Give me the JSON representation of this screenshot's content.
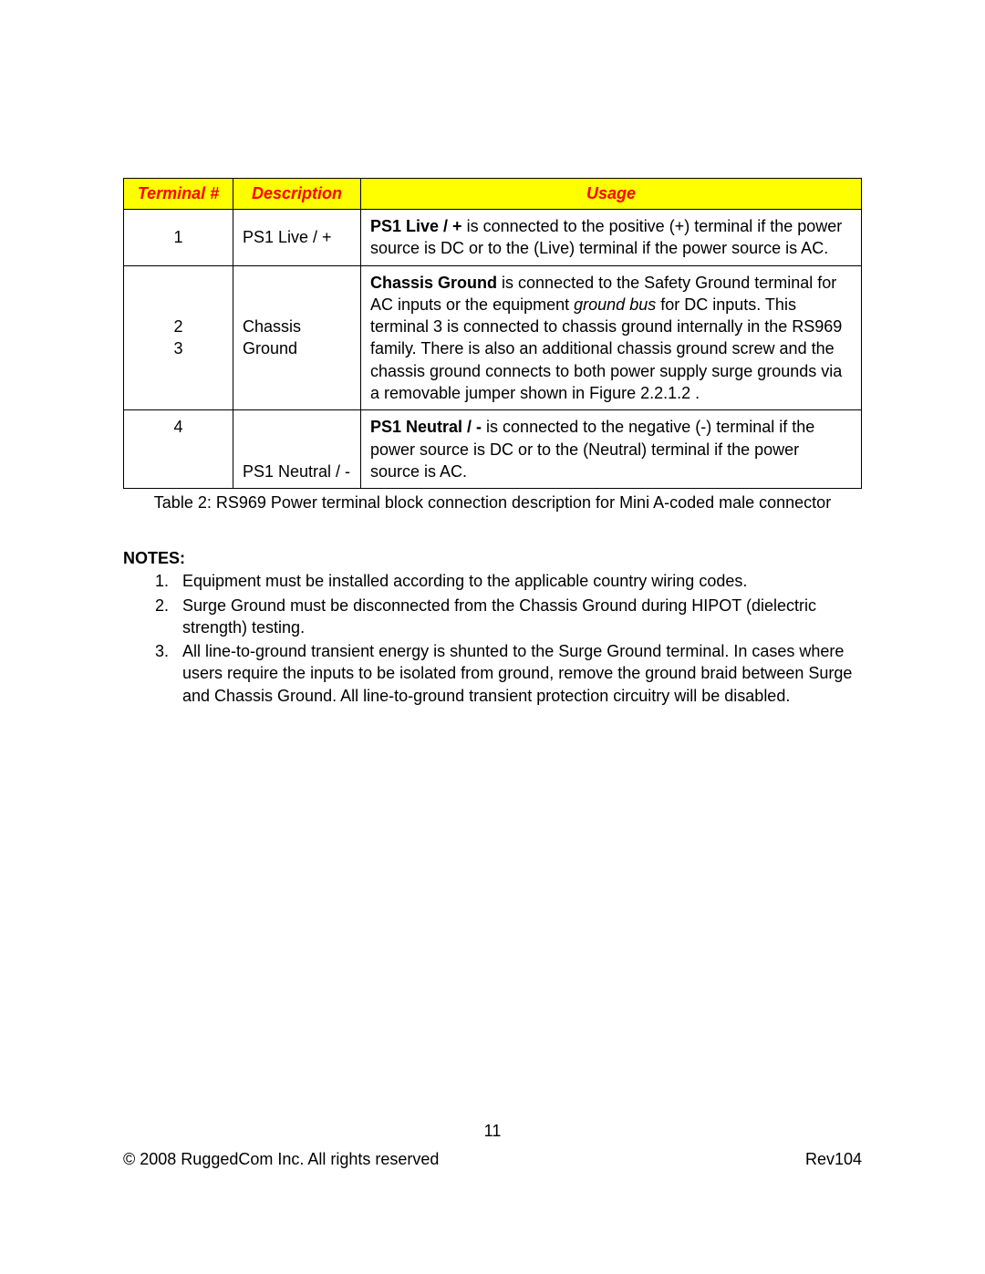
{
  "table": {
    "headers": {
      "terminal": "Terminal #",
      "description": "Description",
      "usage": "Usage"
    },
    "rows": [
      {
        "terminal": "1",
        "description": "PS1  Live / +",
        "usage_bold": "PS1 Live / +",
        "usage_rest": " is connected to the positive (+) terminal if the power source is DC or to the (Live) terminal if the power source is AC."
      },
      {
        "terminal_line1": "2",
        "terminal_line2": "3",
        "description_line1": "Chassis",
        "description_line2": "Ground",
        "usage_bold": "Chassis Ground",
        "usage_seg1": " is connected to the Safety Ground terminal for AC inputs or the equipment ",
        "usage_italic": "ground bus",
        "usage_seg2": " for DC inputs. This terminal 3 is connected to chassis ground internally in the RS969 family. There is also an additional chassis ground screw and the chassis ground connects to both power supply surge grounds via a removable jumper shown in Figure 2.2.1.2 ."
      },
      {
        "terminal": "4",
        "description": "PS1   Neutral / -",
        "usage_bold": "PS1 Neutral / -",
        "usage_rest": " is connected to the negative (-) terminal if the power source is DC or to the (Neutral) terminal if the power source is AC."
      }
    ],
    "caption": "Table 2: RS969 Power terminal block connection description for Mini A-coded male connector"
  },
  "notes": {
    "heading": "NOTES:",
    "items": [
      {
        "num": "1.",
        "text": "Equipment must be installed according to the applicable country wiring codes."
      },
      {
        "num": "2.",
        "text": "Surge Ground must be disconnected from the Chassis Ground during HIPOT (dielectric strength) testing."
      },
      {
        "num": "3.",
        "text": "All line-to-ground transient energy is shunted to the Surge Ground terminal.  In cases where users require the inputs to be isolated from ground, remove the ground braid between Surge and Chassis Ground. All line-to-ground transient protection circuitry will be disabled."
      }
    ]
  },
  "footer": {
    "page_number": "11",
    "copyright": "©  2008 RuggedCom Inc. All rights reserved",
    "revision": "Rev104"
  }
}
